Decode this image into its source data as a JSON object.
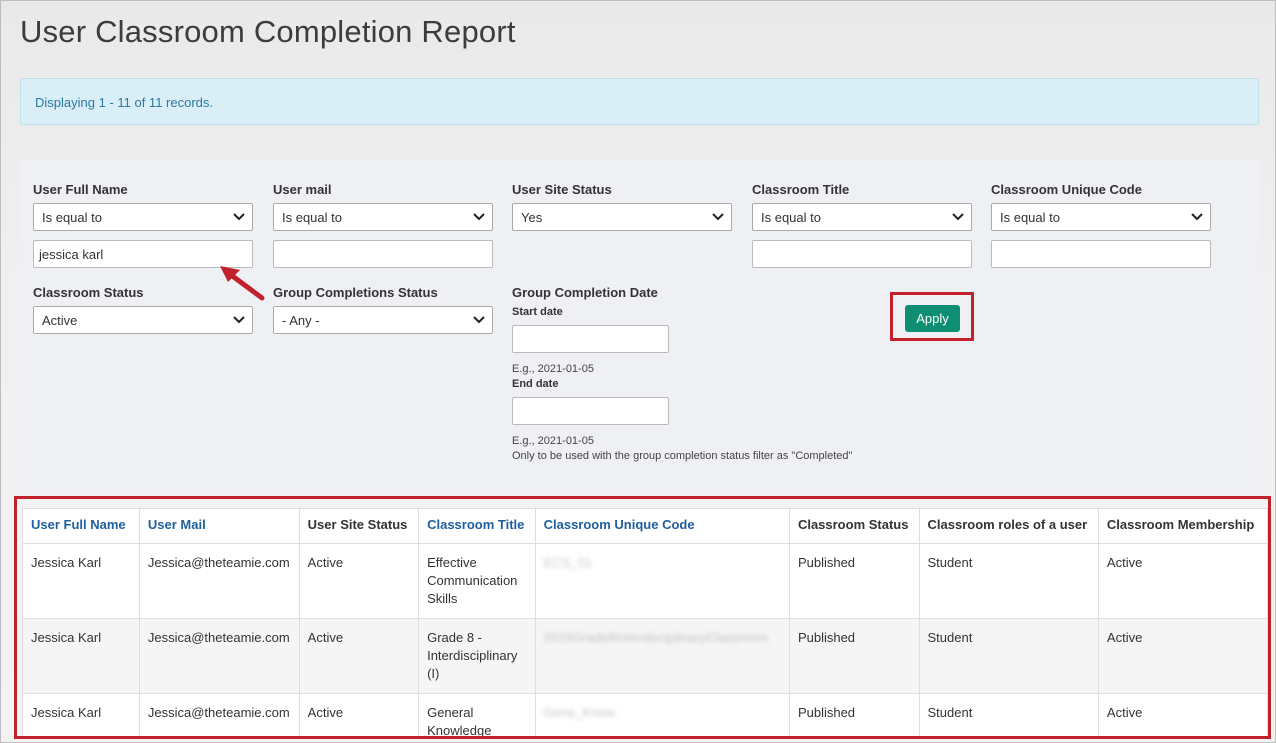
{
  "page": {
    "title": "User Classroom Completion Report",
    "record_summary": "Displaying 1 - 11 of 11 records."
  },
  "filters": {
    "user_full_name": {
      "label": "User Full Name",
      "operator": "Is equal to",
      "value": "jessica karl"
    },
    "user_mail": {
      "label": "User mail",
      "operator": "Is equal to",
      "value": ""
    },
    "user_site_status": {
      "label": "User Site Status",
      "value": "Yes"
    },
    "classroom_title": {
      "label": "Classroom Title",
      "operator": "Is equal to",
      "value": ""
    },
    "classroom_unique_code": {
      "label": "Classroom Unique Code",
      "operator": "Is equal to",
      "value": ""
    },
    "classroom_status": {
      "label": "Classroom Status",
      "value": "Active"
    },
    "group_completions_status": {
      "label": "Group Completions Status",
      "value": "- Any -"
    },
    "group_completion_date": {
      "label": "Group Completion Date",
      "start_label": "Start date",
      "start_hint": "E.g., 2021-01-05",
      "end_label": "End date",
      "end_hint": "E.g., 2021-01-05",
      "note": "Only to be used with the group completion status filter as \"Completed\""
    },
    "apply_label": "Apply"
  },
  "table": {
    "headers": [
      "User Full Name",
      "User Mail",
      "User Site Status",
      "Classroom Title",
      "Classroom Unique Code",
      "Classroom Status",
      "Classroom roles of a user",
      "Classroom Membership"
    ],
    "rows": [
      [
        "Jessica Karl",
        "Jessica@theteamie.com",
        "Active",
        "Effective Communication Skills",
        "ECS_01",
        "Published",
        "Student",
        "Active"
      ],
      [
        "Jessica Karl",
        "Jessica@theteamie.com",
        "Active",
        "Grade 8 - Interdisciplinary (I)",
        "2019Grade8InterdisciplinaryClassroom",
        "Published",
        "Student",
        "Active"
      ],
      [
        "Jessica Karl",
        "Jessica@theteamie.com",
        "Active",
        "General Knowledge",
        "Gene_Know",
        "Published",
        "Student",
        "Active"
      ]
    ]
  },
  "colors": {
    "accent_button": "#0e8f73",
    "highlight_border": "#c0212a",
    "link_header": "#1e5f9e",
    "alert_bg": "#d9eef6"
  }
}
